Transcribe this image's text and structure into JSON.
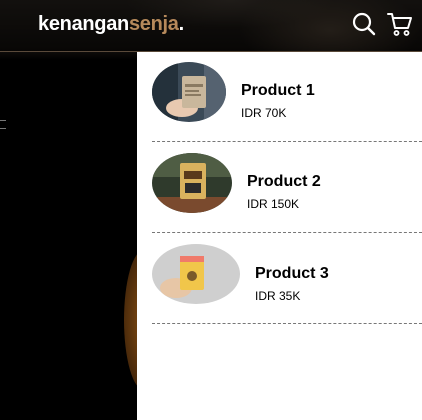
{
  "navbar": {
    "logo_main": "kenangan",
    "logo_accent": "senja",
    "logo_dot": ".",
    "search_icon": "search-icon",
    "cart_icon": "shopping-cart-icon",
    "accent_color": "#b6895b"
  },
  "cart": {
    "items": [
      {
        "name": "Product 1",
        "price": "IDR 70K"
      },
      {
        "name": "Product 2",
        "price": "IDR 150K"
      },
      {
        "name": "Product 3",
        "price": "IDR 35K"
      }
    ]
  }
}
